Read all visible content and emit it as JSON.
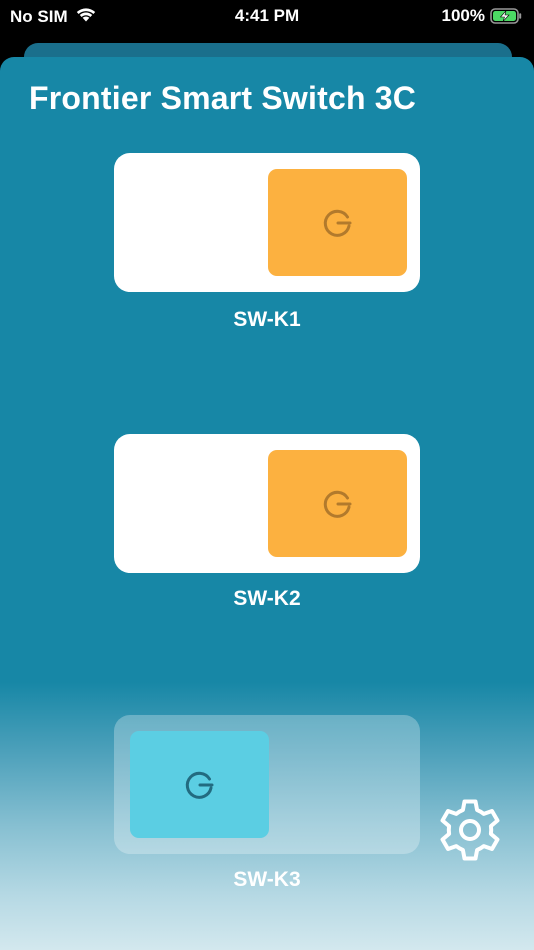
{
  "status_bar": {
    "carrier": "No SIM",
    "time": "4:41 PM",
    "battery": "100%"
  },
  "app": {
    "title": "Frontier Smart Switch 3C"
  },
  "switches": [
    {
      "label": "SW-K1",
      "state": "on",
      "knob_color": "#fcb140"
    },
    {
      "label": "SW-K2",
      "state": "on",
      "knob_color": "#fcb140"
    },
    {
      "label": "SW-K3",
      "state": "off",
      "knob_color": "#5bcee3"
    }
  ],
  "icons": {
    "status": [
      "wifi-icon",
      "battery-charging-icon"
    ],
    "switch_knob": "power-icon",
    "settings": "gear-icon"
  },
  "colors": {
    "background": "#1787a6",
    "on_knob": "#fcb140",
    "off_knob": "#5bcee3",
    "track_on": "#ffffff"
  }
}
